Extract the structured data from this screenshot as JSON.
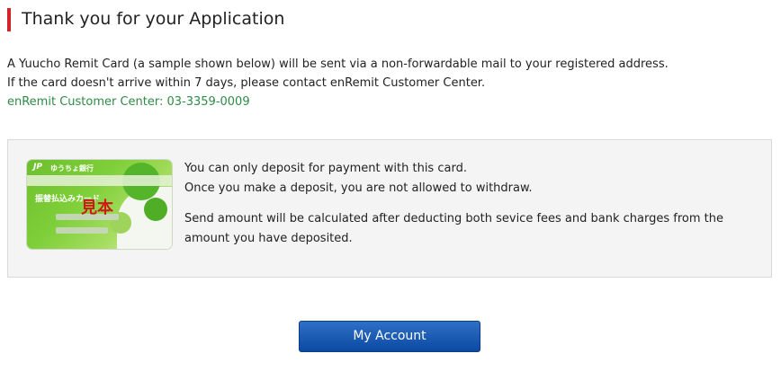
{
  "header": {
    "title": "Thank you for your Application"
  },
  "intro": {
    "line1": "A Yuucho Remit Card (a sample shown below) will be sent via a non-forwardable mail to your registered address.",
    "line2": "If the card doesn't arrive within 7 days, please contact enRemit Customer Center.",
    "contact": "enRemit Customer Center: 03-3359-0009"
  },
  "card_image": {
    "bank_name": "ゆうちょ銀行",
    "card_title": "振替払込みカード",
    "sample_mark": "見本",
    "logo_text": "JP"
  },
  "notes": {
    "line1": "You can only deposit for payment with this card.",
    "line2": "Once you make a deposit, you are not allowed to withdraw.",
    "line3": "Send amount will be calculated after deducting both sevice fees and bank charges from the",
    "line4": "amount you have deposited."
  },
  "actions": {
    "my_account_label": "My Account"
  },
  "colors": {
    "accent_red": "#d2232a",
    "contact_green": "#2e8b46",
    "button_blue": "#0b4aa2"
  }
}
